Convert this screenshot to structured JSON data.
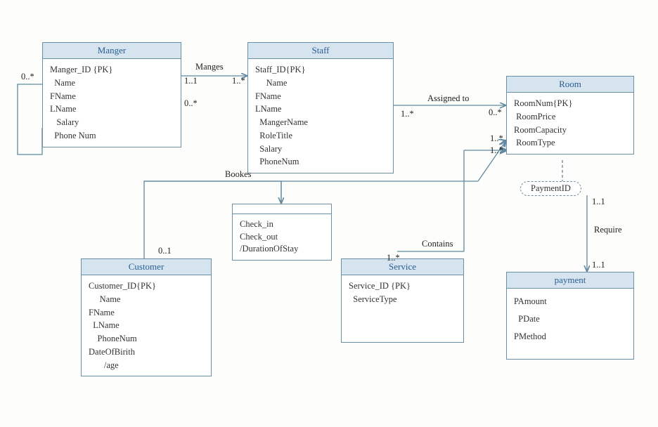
{
  "entities": {
    "manager": {
      "title": "Manger",
      "attrs": [
        "Manger_ID {PK}",
        "  Name",
        "FName",
        "LName",
        "   Salary",
        "  Phone Num"
      ]
    },
    "staff": {
      "title": "Staff",
      "attrs": [
        "Staff_ID{PK}",
        "     Name",
        "FName",
        "LName",
        "  MangerName",
        "  RoleTitle",
        "  Salary",
        "  PhoneNum"
      ]
    },
    "room": {
      "title": "Room",
      "attrs": [
        "RoomNum{PK}",
        " RoomPrice",
        "RoomCapacity",
        " RoomType"
      ]
    },
    "customer": {
      "title": "Customer",
      "attrs": [
        "Customer_ID{PK}",
        "     Name",
        "FName",
        "  LName",
        "    PhoneNum",
        "DateOfBirith",
        "       /age"
      ]
    },
    "service": {
      "title": "Service",
      "attrs": [
        "Service_ID {PK}",
        "  ServiceType"
      ]
    },
    "payment": {
      "title": "payment",
      "attrs": [
        "PAmount",
        "  PDate",
        "PMethod"
      ]
    }
  },
  "assoc": {
    "booking": [
      "Check_in",
      "Check_out",
      "/DurationOfStay"
    ]
  },
  "assoc_class": {
    "payment_id": "PaymentID"
  },
  "relationships": {
    "manages": "Manges",
    "assigned_to": "Assigned to",
    "bookes": "Bookes",
    "contains": "Contains",
    "require": "Require"
  },
  "multiplicities": {
    "mgr_self_left": "0..*",
    "mgr_self_right": "0..*",
    "manages_left": "1..1",
    "manages_right": "1..*",
    "assigned_left": "1..*",
    "assigned_right": "0..*",
    "bookes_cust": "0..1",
    "bookes_room": "1..*",
    "contains_left": "1..*",
    "contains_room": "1..*",
    "require_top": "1..1",
    "require_bottom": "1..1"
  }
}
